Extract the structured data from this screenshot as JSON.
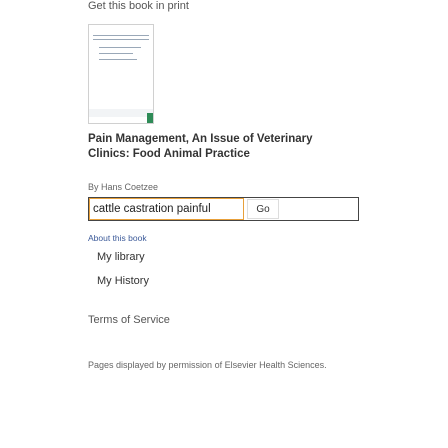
{
  "header": {
    "get_book_text": "Get this book in print"
  },
  "book": {
    "title": "Pain Management, An Issue of Veterinary Clinics: Food Animal Practice",
    "author": "By Hans Coetzee"
  },
  "search": {
    "value": "cattle castration painful",
    "button_label": "Go"
  },
  "links": {
    "about": "About this book",
    "my_library": "My library",
    "my_history": "My History",
    "terms": "Terms of Service"
  },
  "footer": {
    "pages_note": "Pages displayed by permission of Elsevier Health Sciences."
  },
  "colors": {
    "search_border": "#444444",
    "input_focus_border": "#e8a03a",
    "about_link": "#3c5a99"
  }
}
